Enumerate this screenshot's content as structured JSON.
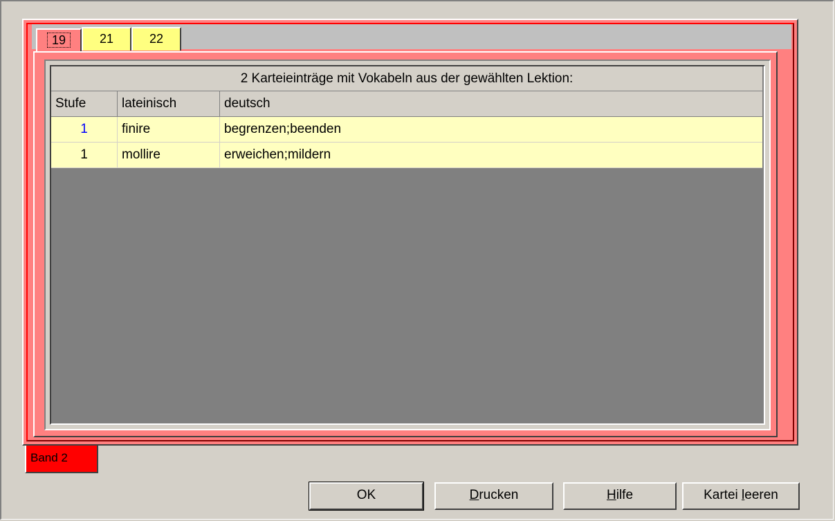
{
  "lektion_tabs": [
    {
      "label": "19",
      "active": true
    },
    {
      "label": "21",
      "active": false
    },
    {
      "label": "22",
      "active": false
    }
  ],
  "grid": {
    "caption": "2 Karteieinträge mit Vokabeln aus der gewählten Lektion:",
    "columns": [
      "Stufe",
      "lateinisch",
      "deutsch"
    ],
    "rows": [
      {
        "stufe": "1",
        "lateinisch": "finire",
        "deutsch": "begrenzen;beenden"
      },
      {
        "stufe": "1",
        "lateinisch": "mollire",
        "deutsch": "erweichen;mildern"
      }
    ]
  },
  "band_tab": {
    "label": "Band 2"
  },
  "buttons": {
    "ok": "OK",
    "drucken_prefix": "D",
    "drucken_rest": "rucken",
    "hilfe_prefix": "H",
    "hilfe_rest": "ilfe",
    "kartei_prefix": "Kartei ",
    "kartei_accel": "l",
    "kartei_rest": "eeren"
  },
  "colors": {
    "dialog_bg": "#d4d0c8",
    "band_page": "#ff8080",
    "band_tab": "#ff0000",
    "lektion_tab": "#ffff80",
    "row_bg": "#ffffc0",
    "grid_empty": "#808080"
  }
}
